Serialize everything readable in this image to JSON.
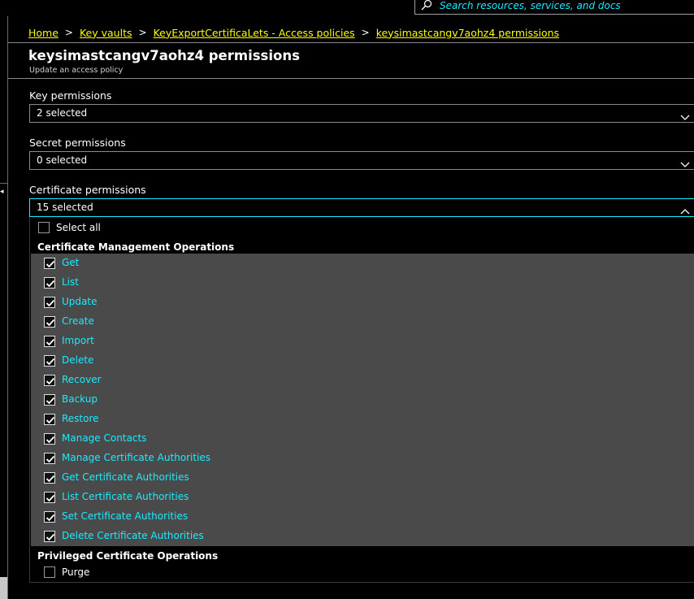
{
  "search": {
    "placeholder": "Search resources, services, and docs"
  },
  "breadcrumb": {
    "items": [
      "Home",
      "Key vaults",
      "KeyExportCertificaLets - Access policies",
      "keysimastcangv7aohz4 permissions"
    ],
    "separator": ">"
  },
  "page": {
    "title": "keysimastcangv7aohz4 permissions",
    "subtitle": "Update an access policy"
  },
  "fields": {
    "key": {
      "label": "Key permissions",
      "value": "2 selected"
    },
    "secret": {
      "label": "Secret permissions",
      "value": "0 selected"
    },
    "certificate": {
      "label": "Certificate permissions",
      "value": "15 selected"
    }
  },
  "certificate_panel": {
    "select_all_label": "Select all",
    "management_header": "Certificate Management Operations",
    "management_ops": [
      "Get",
      "List",
      "Update",
      "Create",
      "Import",
      "Delete",
      "Recover",
      "Backup",
      "Restore",
      "Manage Contacts",
      "Manage Certificate Authorities",
      "Get Certificate Authorities",
      "List Certificate Authorities",
      "Set Certificate Authorities",
      "Delete Certificate Authorities"
    ],
    "privileged_header": "Privileged Certificate Operations",
    "privileged_ops": [
      "Purge"
    ]
  },
  "colors": {
    "accent": "#1aebff",
    "link": "#ffff00",
    "list_background": "#4a4a4a"
  }
}
